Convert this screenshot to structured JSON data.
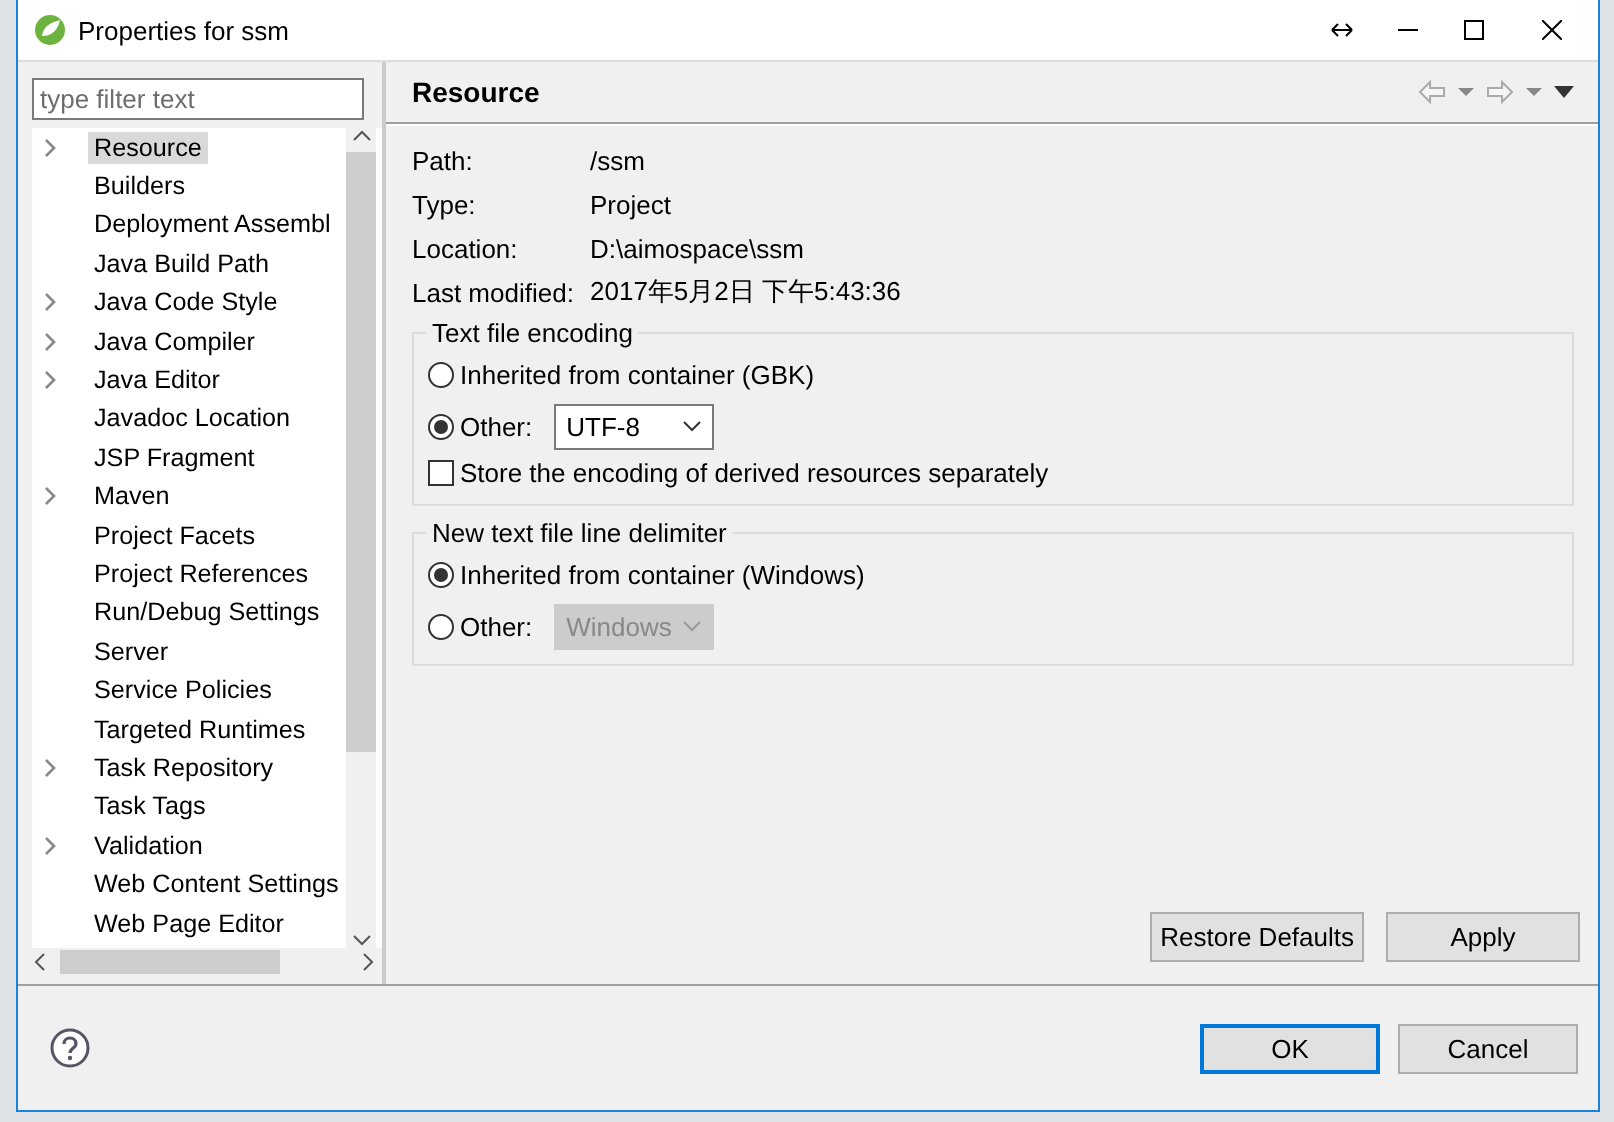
{
  "window": {
    "title": "Properties for ssm"
  },
  "filter": {
    "placeholder": "type filter text"
  },
  "tree": {
    "items": [
      {
        "label": "Resource",
        "has_children": true,
        "selected": true
      },
      {
        "label": "Builders",
        "has_children": false,
        "selected": false
      },
      {
        "label": "Deployment Assembl",
        "has_children": false,
        "selected": false
      },
      {
        "label": "Java Build Path",
        "has_children": false,
        "selected": false
      },
      {
        "label": "Java Code Style",
        "has_children": true,
        "selected": false
      },
      {
        "label": "Java Compiler",
        "has_children": true,
        "selected": false
      },
      {
        "label": "Java Editor",
        "has_children": true,
        "selected": false
      },
      {
        "label": "Javadoc Location",
        "has_children": false,
        "selected": false
      },
      {
        "label": "JSP Fragment",
        "has_children": false,
        "selected": false
      },
      {
        "label": "Maven",
        "has_children": true,
        "selected": false
      },
      {
        "label": "Project Facets",
        "has_children": false,
        "selected": false
      },
      {
        "label": "Project References",
        "has_children": false,
        "selected": false
      },
      {
        "label": "Run/Debug Settings",
        "has_children": false,
        "selected": false
      },
      {
        "label": "Server",
        "has_children": false,
        "selected": false
      },
      {
        "label": "Service Policies",
        "has_children": false,
        "selected": false
      },
      {
        "label": "Targeted Runtimes",
        "has_children": false,
        "selected": false
      },
      {
        "label": "Task Repository",
        "has_children": true,
        "selected": false
      },
      {
        "label": "Task Tags",
        "has_children": false,
        "selected": false
      },
      {
        "label": "Validation",
        "has_children": true,
        "selected": false
      },
      {
        "label": "Web Content Settings",
        "has_children": false,
        "selected": false
      },
      {
        "label": "Web Page Editor",
        "has_children": false,
        "selected": false
      }
    ]
  },
  "page": {
    "title": "Resource",
    "properties": [
      {
        "label": "Path:",
        "value": "/ssm"
      },
      {
        "label": "Type:",
        "value": "Project"
      },
      {
        "label": "Location:",
        "value": "D:\\aimospace\\ssm"
      },
      {
        "label": "Last modified:",
        "value": "2017年5月2日 下午5:43:36"
      }
    ],
    "groups": [
      {
        "title": "Text file encoding",
        "options": [
          {
            "kind": "radio",
            "label": "Inherited from container (GBK)",
            "selected": false
          },
          {
            "kind": "radio-combo",
            "label": "Other:",
            "selected": true,
            "value": "UTF-8",
            "disabled": false
          }
        ],
        "checkbox": {
          "label": "Store the encoding of derived resources separately",
          "checked": false
        }
      },
      {
        "title": "New text file line delimiter",
        "options": [
          {
            "kind": "radio",
            "label": "Inherited from container (Windows)",
            "selected": true
          },
          {
            "kind": "radio-combo",
            "label": "Other:",
            "selected": false,
            "value": "Windows",
            "disabled": true
          }
        ]
      }
    ],
    "buttons": [
      "Restore Defaults",
      "Apply"
    ]
  },
  "footer": {
    "buttons": [
      {
        "label": "OK",
        "default": true
      },
      {
        "label": "Cancel",
        "default": false
      }
    ]
  }
}
